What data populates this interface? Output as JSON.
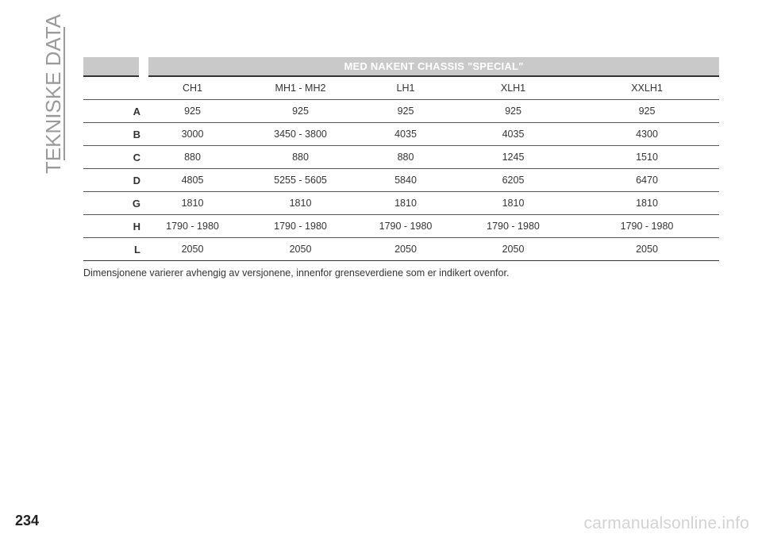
{
  "section_title": "TEKNISKE DATA",
  "table": {
    "title": "MED NAKENT CHASSIS \"SPECIAL\"",
    "columns": [
      "",
      "CH1",
      "MH1 - MH2",
      "LH1",
      "XLH1",
      "XXLH1"
    ],
    "rows": [
      {
        "label": "A",
        "values": [
          "925",
          "925",
          "925",
          "925",
          "925"
        ]
      },
      {
        "label": "B",
        "values": [
          "3000",
          "3450 - 3800",
          "4035",
          "4035",
          "4300"
        ]
      },
      {
        "label": "C",
        "values": [
          "880",
          "880",
          "880",
          "1245",
          "1510"
        ]
      },
      {
        "label": "D",
        "values": [
          "4805",
          "5255 - 5605",
          "5840",
          "6205",
          "6470"
        ]
      },
      {
        "label": "G",
        "values": [
          "1810",
          "1810",
          "1810",
          "1810",
          "1810"
        ]
      },
      {
        "label": "H",
        "values": [
          "1790 - 1980",
          "1790 - 1980",
          "1790 - 1980",
          "1790 - 1980",
          "1790 - 1980"
        ]
      },
      {
        "label": "L",
        "values": [
          "2050",
          "2050",
          "2050",
          "2050",
          "2050"
        ]
      }
    ]
  },
  "note": "Dimensjonene varierer avhengig av versjonene, innenfor grenseverdiene som er indikert ovenfor.",
  "page_number": "234",
  "watermark": "carmanualsonline.info"
}
